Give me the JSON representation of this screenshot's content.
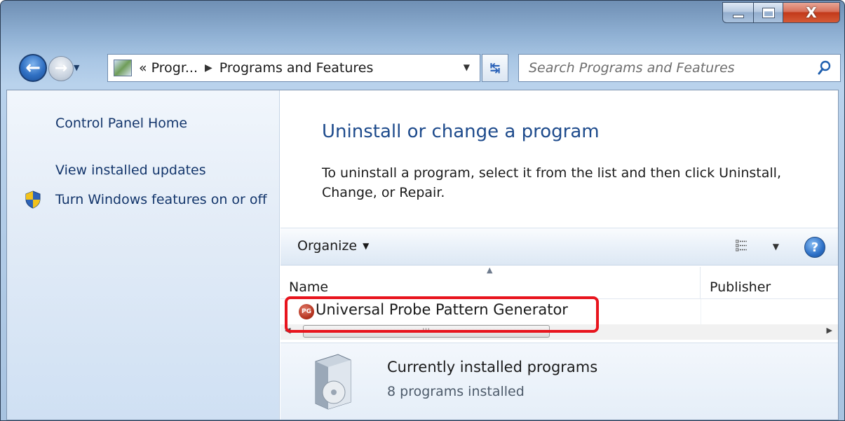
{
  "window": {
    "caption": {
      "minimize_icon": "minimize-icon",
      "maximize_icon": "maximize-icon",
      "close_label": "X"
    }
  },
  "nav": {
    "back_icon": "back-arrow-icon",
    "forward_icon": "forward-arrow-icon",
    "breadcrumb_prefix": "«",
    "breadcrumb_parent": "Progr...",
    "breadcrumb_separator": "▶",
    "breadcrumb_current": "Programs and Features",
    "refresh_icon": "refresh-icon",
    "search_placeholder": "Search Programs and Features"
  },
  "sidebar": {
    "items": [
      {
        "label": "Control Panel Home"
      },
      {
        "label": "View installed updates"
      },
      {
        "label": "Turn Windows features on or off",
        "icon": "shield-icon"
      }
    ]
  },
  "main": {
    "title": "Uninstall or change a program",
    "description": "To uninstall a program, select it from the list and then click Uninstall, Change, or Repair."
  },
  "toolbar": {
    "organize_label": "Organize",
    "view_icon": "view-list-icon",
    "help_icon": "help-icon",
    "help_label": "?"
  },
  "list": {
    "columns": [
      {
        "label": "Name"
      },
      {
        "label": "Publisher"
      }
    ],
    "rows": [
      {
        "icon_label": "PG",
        "name": "Universal Probe Pattern Generator",
        "publisher": ""
      }
    ],
    "scroll_thumb_label": "III"
  },
  "details": {
    "title": "Currently installed programs",
    "subtitle": "8 programs installed"
  },
  "colors": {
    "link": "#13356b",
    "title": "#1e4b8c",
    "highlight": "#e8141d"
  }
}
